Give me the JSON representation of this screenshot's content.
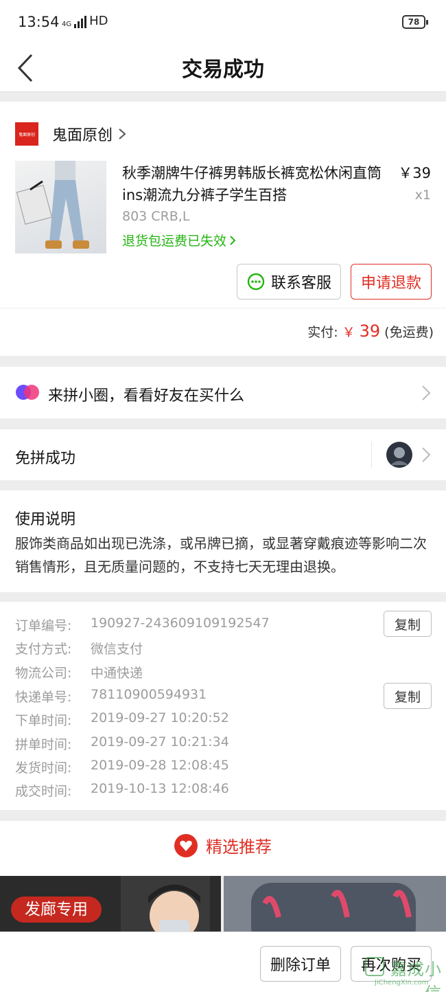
{
  "status_bar": {
    "time": "13:54",
    "network": "4G",
    "hd": "HD",
    "battery": "78"
  },
  "nav": {
    "title": "交易成功"
  },
  "order_item": {
    "shop_logo_text": "鬼面原创",
    "shop_name": "鬼面原创",
    "product_title": "秋季潮牌牛仔裤男韩版长裤宽松休闲直筒ins潮流九分裤子学生百搭",
    "price": "￥39",
    "quantity": "x1",
    "sku": "803 CRB,L",
    "refund_shipping": "退货包运费已失效",
    "contact_label": "联系客服",
    "refund_label": "申请退款",
    "paid_label": "实付:",
    "paid_currency": "￥",
    "paid_amount": "39",
    "paid_note": "(免运费)"
  },
  "circle_row": {
    "label": "来拼小圈，看看好友在买什么"
  },
  "group_row": {
    "label": "免拼成功"
  },
  "usage": {
    "title": "使用说明",
    "body": "服饰类商品如出现已洗涤，或吊牌已摘，或显著穿戴痕迹等影响二次销售情形，且无质量问题的，不支持七天无理由退换。"
  },
  "order_info": {
    "copy_label": "复制",
    "rows": [
      {
        "key": "订单编号:",
        "value": "190927-243609109192547"
      },
      {
        "key": "支付方式:",
        "value": "微信支付"
      },
      {
        "key": "物流公司:",
        "value": "中通快递"
      },
      {
        "key": "快递单号:",
        "value": "78110900594931"
      },
      {
        "key": "下单时间:",
        "value": "2019-09-27 10:20:52"
      },
      {
        "key": "拼单时间:",
        "value": "2019-09-27 10:21:34"
      },
      {
        "key": "发货时间:",
        "value": "2019-09-28 12:08:45"
      },
      {
        "key": "成交时间:",
        "value": "2019-10-13 12:08:46"
      }
    ]
  },
  "recommend": {
    "title": "精选推荐",
    "banner_left_tag": "发廊专用"
  },
  "bottom_bar": {
    "delete_label": "删除订单",
    "rebuy_label": "再次购买"
  },
  "watermark": {
    "cn": "嘉成小信",
    "en": "JiChengXin.com"
  },
  "colors": {
    "accent_red": "#e02e24",
    "success_green": "#25b513"
  }
}
